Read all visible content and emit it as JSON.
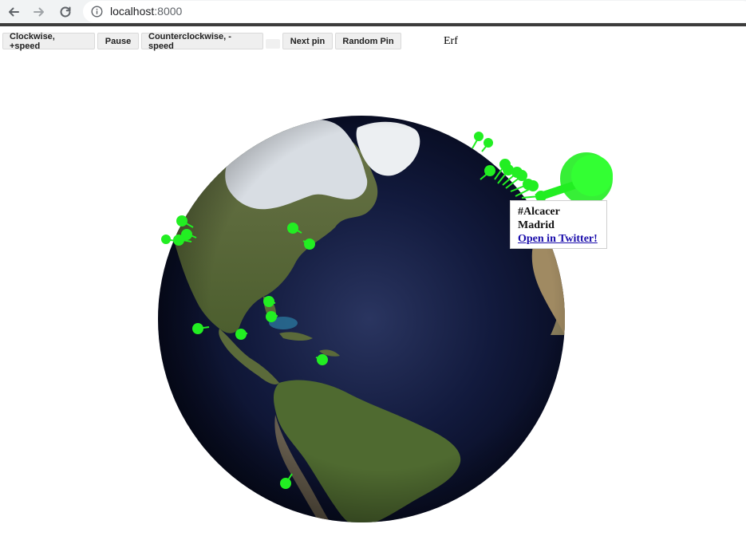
{
  "browser": {
    "url_host": "localhost",
    "url_port": ":8000"
  },
  "toolbar": {
    "clockwise_label": "Clockwise, +speed",
    "pause_label": "Pause",
    "counterclockwise_label": "Counterclockwise, -speed",
    "next_pin_label": "Next pin",
    "random_pin_label": "Random Pin",
    "status_text": "Erf"
  },
  "popup": {
    "hashtag": "#Alcacer",
    "location": "Madrid",
    "link_label": "Open in Twitter!"
  },
  "colors": {
    "pin": "#22ee22",
    "ocean": "#0d1535",
    "land": "#5b6a3a",
    "ice": "#d9dde2"
  },
  "icons": {
    "back": "arrow-left-icon",
    "forward": "arrow-right-icon",
    "reload": "reload-icon",
    "info": "info-icon"
  }
}
